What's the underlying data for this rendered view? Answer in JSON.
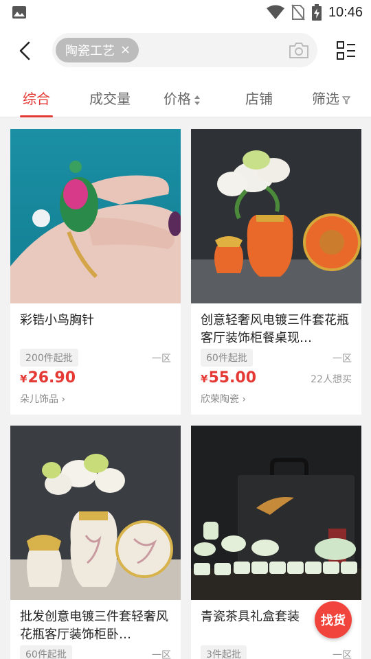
{
  "status_bar": {
    "time": "10:46"
  },
  "search": {
    "chip_label": "陶瓷工艺",
    "chip_clear": "×"
  },
  "tabs": [
    {
      "label": "综合"
    },
    {
      "label": "成交量"
    },
    {
      "label": "价格"
    },
    {
      "label": "店铺"
    },
    {
      "label": "筛选"
    }
  ],
  "products": [
    {
      "title": "彩锆小鸟胸针",
      "moq": "200件起批",
      "region": "一区",
      "currency": "¥",
      "price": "26.90",
      "wants": "",
      "shop": "朵儿饰品"
    },
    {
      "title": "创意轻奢风电镀三件套花瓶客厅装饰柜餐桌现…",
      "moq": "60件起批",
      "region": "一区",
      "currency": "¥",
      "price": "55.00",
      "wants": "22人想买",
      "shop": "欣荣陶瓷"
    },
    {
      "title": "批发创意电镀三件套轻奢风花瓶客厅装饰柜卧…",
      "moq": "60件起批",
      "region": "一区"
    },
    {
      "title": "青瓷茶具礼盒套装",
      "moq": "3件起批",
      "region": "一区"
    }
  ],
  "fab": {
    "label": "找货"
  },
  "colors": {
    "accent": "#e53935",
    "fab": "#f0443c"
  }
}
